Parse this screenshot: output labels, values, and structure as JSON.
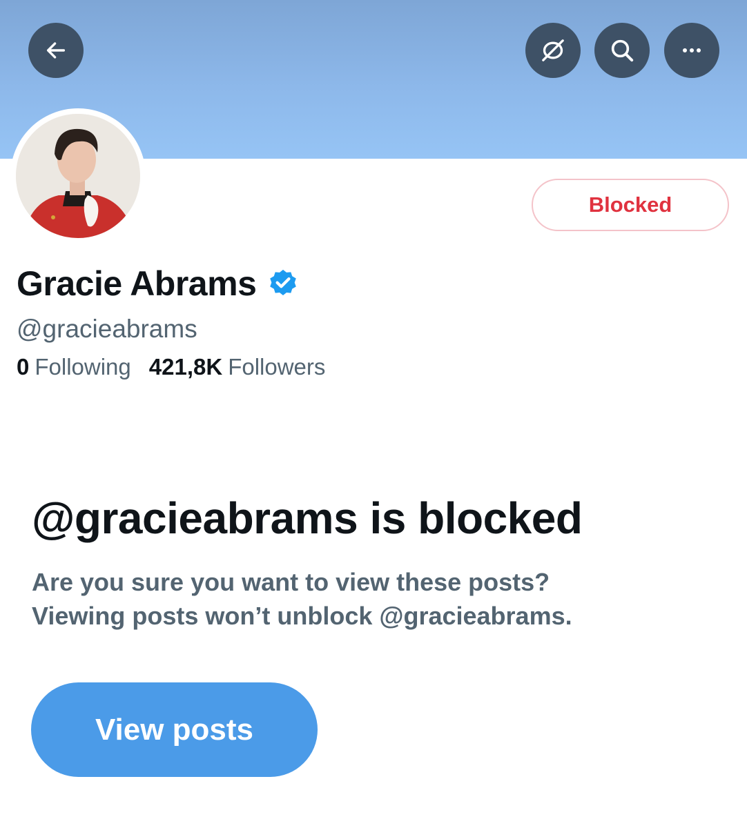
{
  "header": {
    "back_icon": "arrow-left-icon",
    "actions": [
      {
        "icon": "eye-slash-icon"
      },
      {
        "icon": "search-icon"
      },
      {
        "icon": "more-horizontal-icon"
      }
    ],
    "banner_color": "#8db8ea"
  },
  "profile": {
    "name": "Gracie Abrams",
    "verified_icon": "verified-badge-icon",
    "verified_color": "#1d9bf0",
    "handle": "@gracieabrams",
    "following_count": "0",
    "following_label": "Following",
    "followers_count": "421,8K",
    "followers_label": "Followers",
    "status_button_label": "Blocked",
    "status_color": "#e0323f"
  },
  "blocked_notice": {
    "title": "@gracieabrams is blocked",
    "message_line1": "Are you sure you want to view these posts?",
    "message_line2": "Viewing posts won’t unblock @gracieabrams.",
    "button_label": "View posts",
    "button_color": "#4b9be8"
  }
}
